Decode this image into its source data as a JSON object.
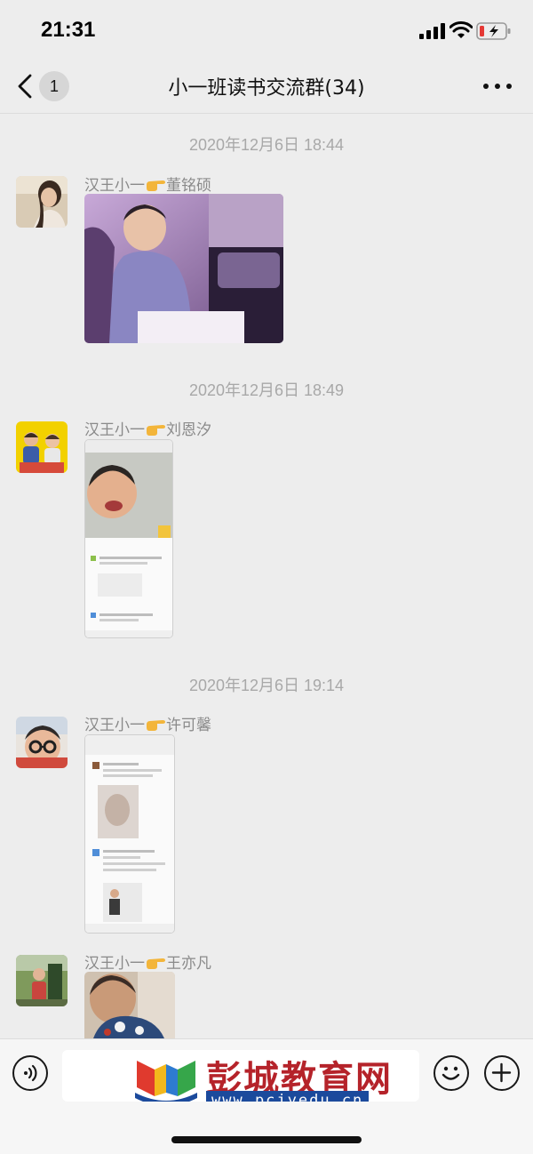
{
  "status_bar": {
    "time": "21:31"
  },
  "header": {
    "back_badge": "1",
    "title": "小一班读书交流群(34)"
  },
  "messages": [
    {
      "timestamp": "2020年12月6日 18:44",
      "sender": "汉王小一",
      "sender_name": "董铭硕",
      "content_type": "photo"
    },
    {
      "timestamp": "2020年12月6日 18:49",
      "sender": "汉王小一",
      "sender_name": "刘恩汐",
      "content_type": "screenshot"
    },
    {
      "timestamp": "2020年12月6日 19:14",
      "sender": "汉王小一",
      "sender_name": "许可馨",
      "content_type": "screenshot"
    },
    {
      "timestamp": "",
      "sender": "汉王小一",
      "sender_name": "王亦凡",
      "content_type": "photo"
    }
  ],
  "watermark": {
    "name": "彭城教育网",
    "url": "www.pcjyedu.cn"
  },
  "icons": {
    "back": "chevron-left-icon",
    "more": "more-dots-icon",
    "voice": "voice-icon",
    "emoji": "emoji-icon",
    "plus": "plus-icon",
    "sender_emoji": "pointing-hand-icon"
  },
  "colors": {
    "background": "#ededed",
    "watermark_red": "#b5232a",
    "watermark_blue": "#1b4a9c"
  }
}
